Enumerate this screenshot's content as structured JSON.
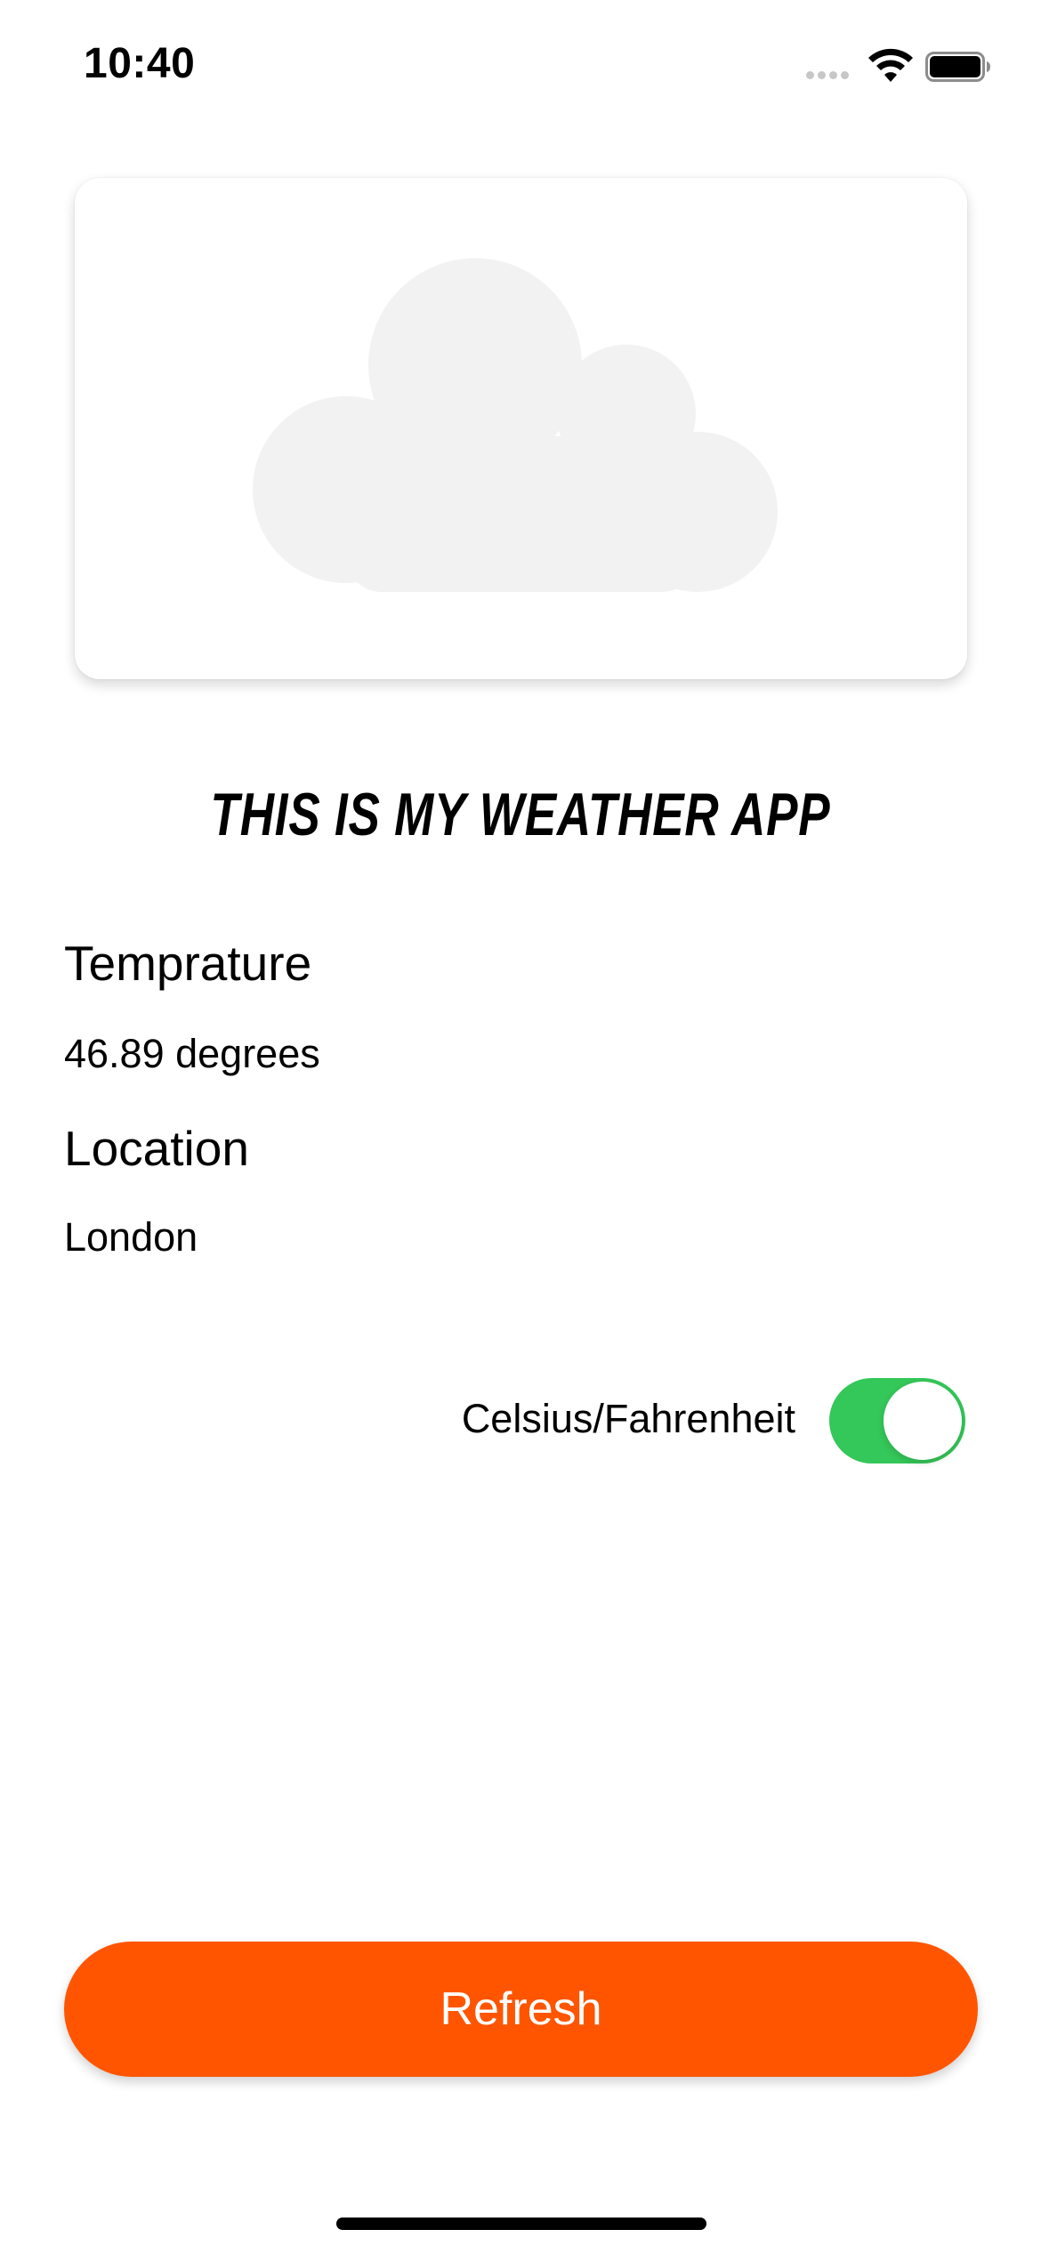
{
  "status_bar": {
    "time": "10:40",
    "icons": [
      "cellular-signal-icon",
      "wifi-icon",
      "battery-icon"
    ]
  },
  "card": {
    "icon": "cloud-icon",
    "icon_color": "#f2f2f2"
  },
  "title": "THIS IS MY WEATHER APP",
  "temperature": {
    "label": "Temprature",
    "value": "46.89 degrees"
  },
  "location": {
    "label": "Location",
    "value": "London"
  },
  "unit_toggle": {
    "label": "Celsius/Fahrenheit",
    "on": true,
    "color": "#34c759"
  },
  "refresh_button": {
    "label": "Refresh",
    "color": "#ff5500"
  }
}
